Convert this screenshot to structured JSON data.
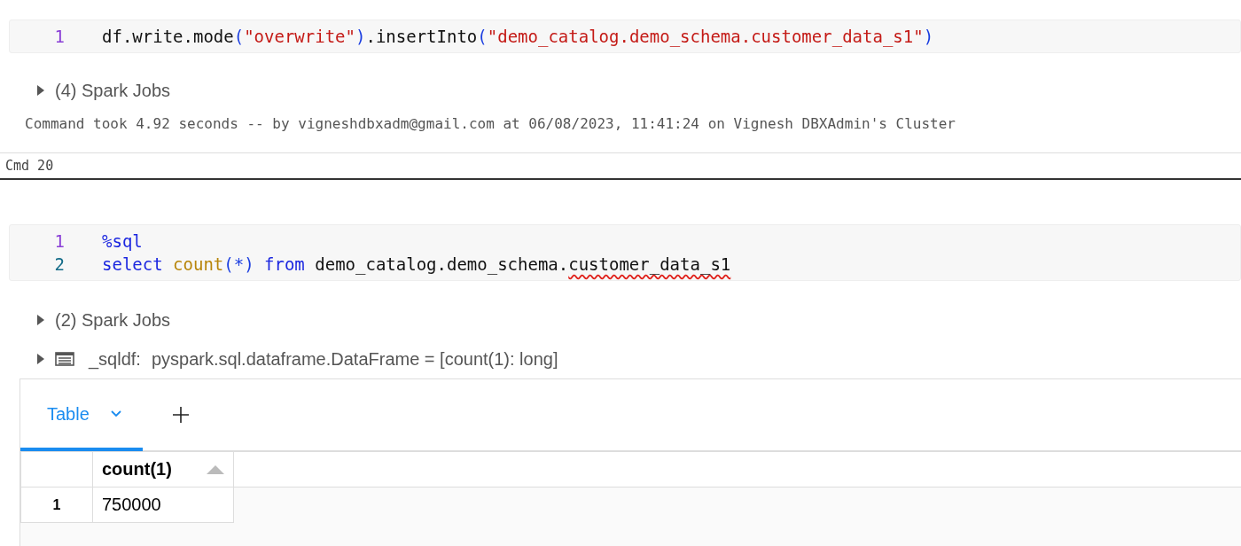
{
  "cells": [
    {
      "code": [
        {
          "number": "1",
          "tokens": [
            {
              "kind": "plain",
              "text": "df.write.mode"
            },
            {
              "kind": "paren",
              "text": "("
            },
            {
              "kind": "string",
              "text": "\"overwrite\""
            },
            {
              "kind": "paren",
              "text": ")"
            },
            {
              "kind": "plain",
              "text": ".insertInto"
            },
            {
              "kind": "paren",
              "text": "("
            },
            {
              "kind": "string",
              "text": "\"demo_catalog.demo_schema.customer_data_s1\""
            },
            {
              "kind": "paren",
              "text": ")"
            }
          ]
        }
      ],
      "spark_jobs": "(4) Spark Jobs",
      "command_info": "Command took 4.92 seconds -- by vigneshdbxadm@gmail.com at 06/08/2023, 11:41:24 on Vignesh DBXAdmin's Cluster"
    }
  ],
  "cmd_label": "Cmd 20",
  "sql_cell": {
    "code": [
      {
        "number": "1",
        "tokens": [
          {
            "kind": "magic",
            "text": "%sql"
          }
        ]
      },
      {
        "number": "2",
        "tokens": [
          {
            "kind": "keyword",
            "text": "select "
          },
          {
            "kind": "function",
            "text": "count"
          },
          {
            "kind": "paren",
            "text": "(*) "
          },
          {
            "kind": "keyword",
            "text": "from"
          },
          {
            "kind": "plain",
            "text": " demo_catalog.demo_schema."
          },
          {
            "kind": "flagged",
            "text": "customer_data_s1"
          }
        ]
      }
    ],
    "spark_jobs": "(2) Spark Jobs",
    "dataframe_name": "_sqldf:",
    "dataframe_type": "pyspark.sql.dataframe.DataFrame = [count(1): long]",
    "tabs": [
      {
        "label": "Table",
        "selected": true
      }
    ],
    "table": {
      "columns": [
        "count(1)"
      ],
      "rows": [
        {
          "index": "1",
          "cells": [
            "750000"
          ]
        }
      ]
    }
  }
}
